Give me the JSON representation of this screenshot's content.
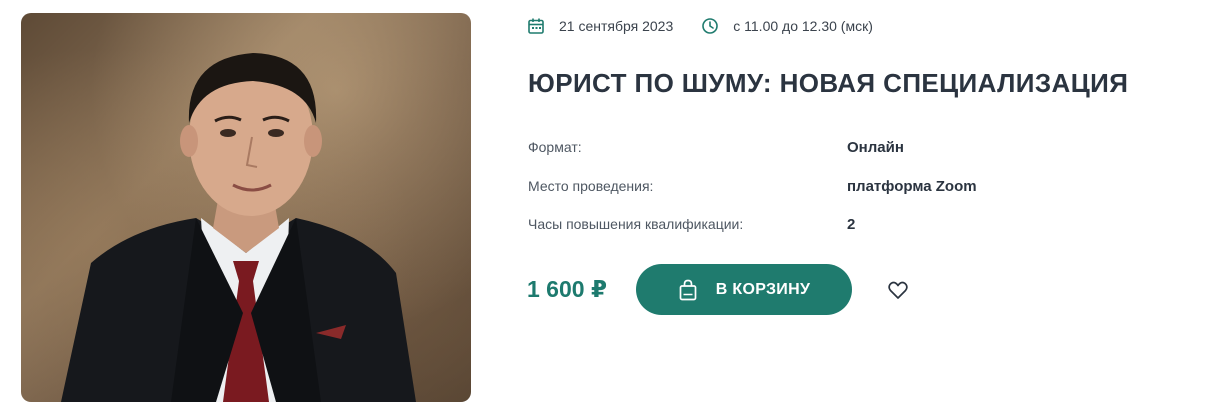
{
  "event": {
    "date": "21 сентября 2023",
    "time": "с 11.00 до 12.30 (мск)",
    "title": "ЮРИСТ ПО ШУМУ: НОВАЯ СПЕЦИАЛИЗАЦИЯ",
    "details": [
      {
        "label": "Формат:",
        "value": "Онлайн"
      },
      {
        "label": "Место проведения:",
        "value": "платформа Zoom"
      },
      {
        "label": "Часы повышения квалификации:",
        "value": "2"
      }
    ],
    "price": "1 600 ₽",
    "cart_label": "В КОРЗИНУ"
  },
  "icons": {
    "date": "calendar-icon",
    "time": "clock-icon",
    "cart": "shopping-bag-icon",
    "favorite": "heart-icon"
  },
  "colors": {
    "accent": "#1f7b6e",
    "price": "#1d7a6e",
    "text": "#2b3440"
  }
}
